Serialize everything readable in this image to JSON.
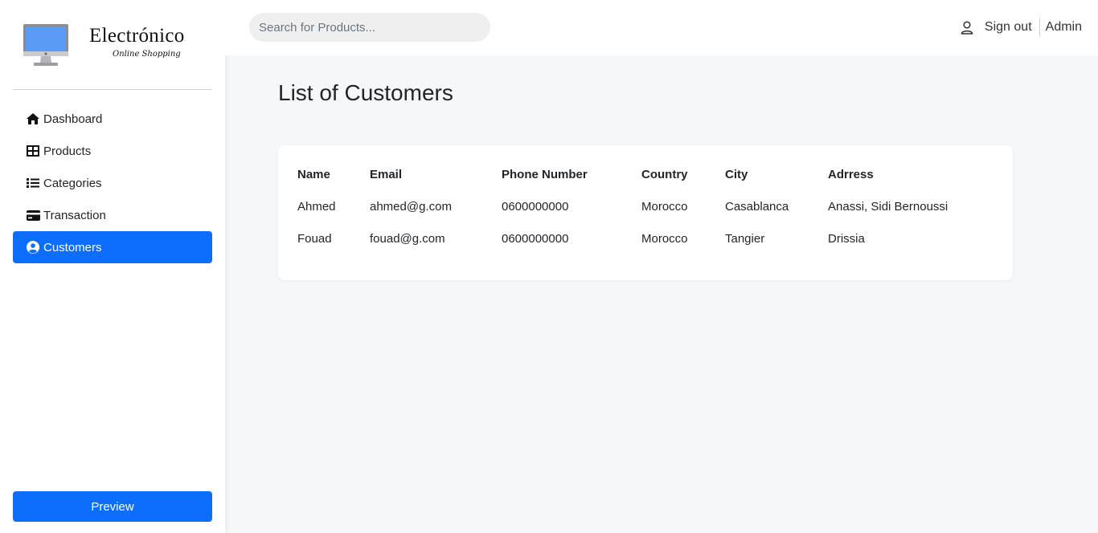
{
  "app": {
    "brand": "Electrónico",
    "tagline": "Online Shopping"
  },
  "sidebar": {
    "items": [
      {
        "label": "Dashboard",
        "icon": "home-icon",
        "active": false
      },
      {
        "label": "Products",
        "icon": "table-icon",
        "active": false
      },
      {
        "label": "Categories",
        "icon": "list-icon",
        "active": false
      },
      {
        "label": "Transaction",
        "icon": "credit-card-icon",
        "active": false
      },
      {
        "label": "Customers",
        "icon": "user-circle-icon",
        "active": true
      }
    ],
    "preview_label": "Preview"
  },
  "header": {
    "search_placeholder": "Search for Products...",
    "signout_label": "Sign out",
    "user_label": "Admin"
  },
  "page": {
    "title": "List of Customers"
  },
  "table": {
    "columns": [
      "Name",
      "Email",
      "Phone Number",
      "Country",
      "City",
      "Adrress"
    ],
    "rows": [
      [
        "Ahmed",
        "ahmed@g.com",
        "0600000000",
        "Morocco",
        "Casablanca",
        "Anassi, Sidi Bernoussi"
      ],
      [
        "Fouad",
        "fouad@g.com",
        "0600000000",
        "Morocco",
        "Tangier",
        "Drissia"
      ]
    ]
  },
  "colors": {
    "accent": "#0d6efd",
    "background": "#f6f7f9"
  }
}
